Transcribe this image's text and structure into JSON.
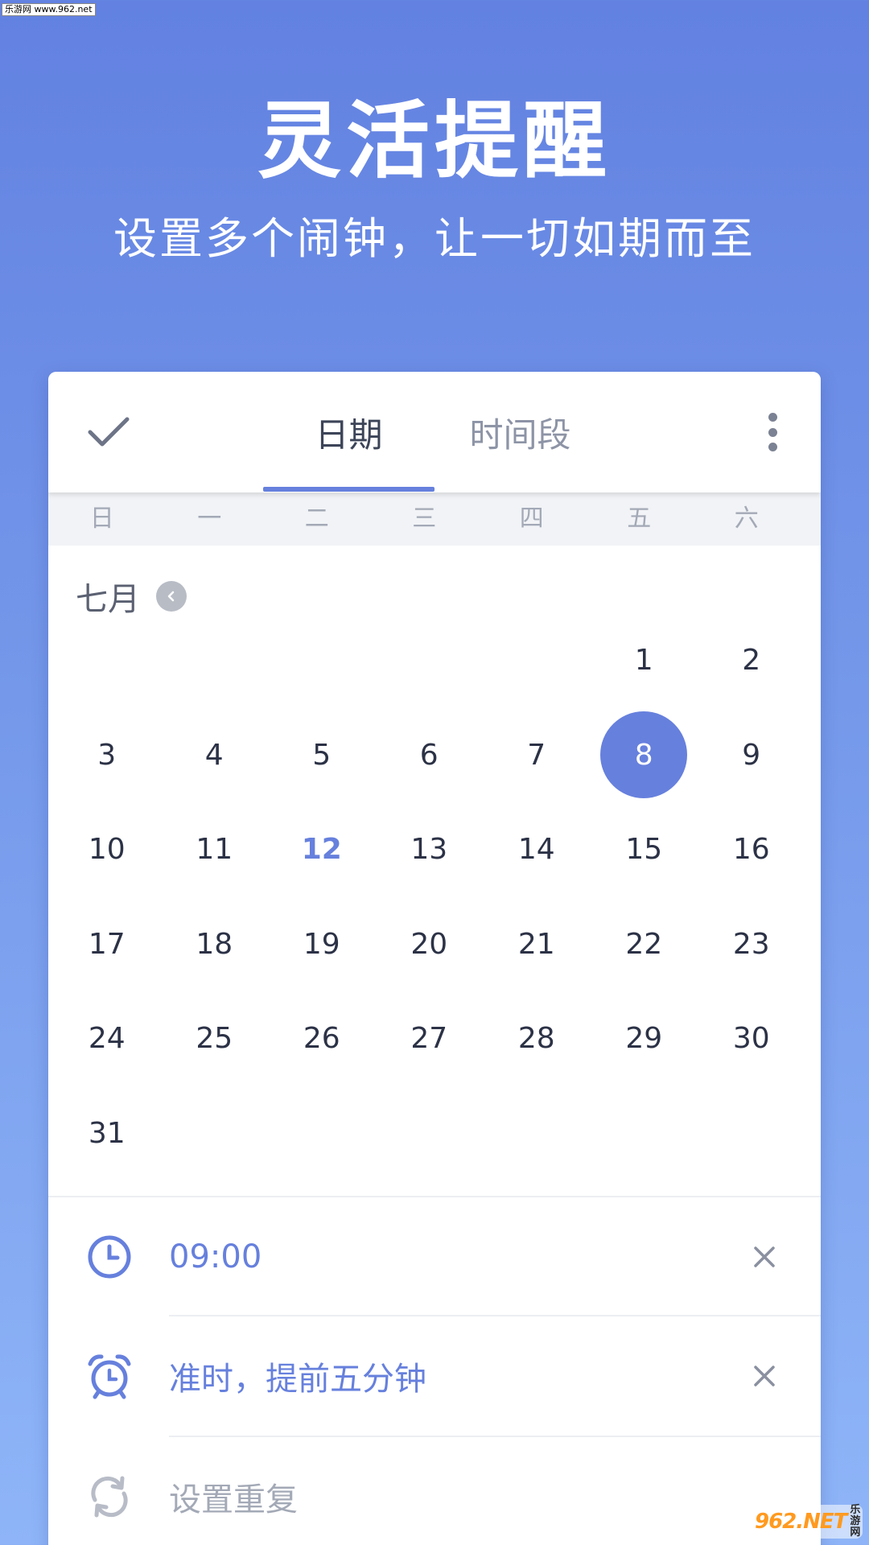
{
  "watermark_top": "乐游网 www.962.net",
  "hero": {
    "title": "灵活提醒",
    "subtitle": "设置多个闹钟，让一切如期而至"
  },
  "header": {
    "tabs": [
      {
        "label": "日期",
        "active": true
      },
      {
        "label": "时间段",
        "active": false
      }
    ]
  },
  "weekdays": [
    "日",
    "一",
    "二",
    "三",
    "四",
    "五",
    "六"
  ],
  "calendar": {
    "month": "七月",
    "leading_blanks": 5,
    "selected_day": "8",
    "today": "12",
    "days": [
      "1",
      "2",
      "3",
      "4",
      "5",
      "6",
      "7",
      "8",
      "9",
      "10",
      "11",
      "12",
      "13",
      "14",
      "15",
      "16",
      "17",
      "18",
      "19",
      "20",
      "21",
      "22",
      "23",
      "24",
      "25",
      "26",
      "27",
      "28",
      "29",
      "30",
      "31"
    ]
  },
  "reminder": {
    "time": "09:00",
    "alarm": "准时，提前五分钟",
    "repeat_placeholder": "设置重复"
  },
  "watermark_br": {
    "logo": "962.NET",
    "sub": "乐游网"
  },
  "colors": {
    "accent": "#6680dd",
    "text": "#2c3246",
    "muted": "#a3a9b6"
  },
  "icons": {
    "confirm": "checkmark-icon",
    "more": "more-vertical-icon",
    "prev_month": "chevron-left-icon",
    "time": "clock-icon",
    "alarm": "alarm-clock-icon",
    "repeat": "repeat-icon",
    "clear": "close-icon"
  }
}
